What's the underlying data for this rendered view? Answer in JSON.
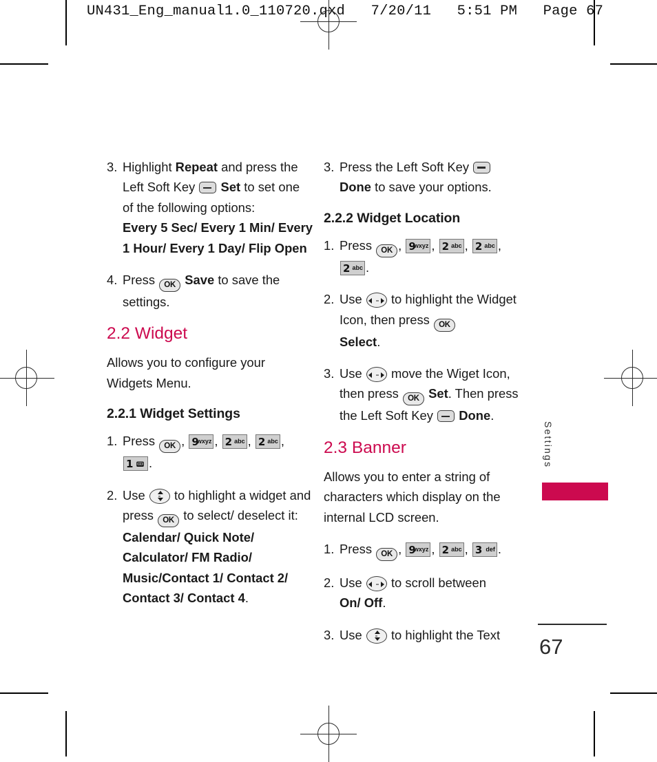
{
  "page": {
    "print_header": "UN431_Eng_manual1.0_110720.qxd   7/20/11   5:51 PM   Page 67",
    "folio": "67",
    "side_tab": "Settings",
    "accent_color": "#cc0a4f",
    "text_color": "#1a1a1a"
  },
  "left_column": {
    "step3": {
      "num": "3.",
      "t1": "Highlight ",
      "b1": "Repeat",
      "t2": " and press the Left Soft Key ",
      "key": "left-soft-key",
      "b2": "Set",
      "t3": " to set one of the following options:",
      "options": "Every 5 Sec/ Every 1 Min/ Every 1 Hour/ Every 1 Day/ Flip Open"
    },
    "step4": {
      "num": "4.",
      "t1": "Press ",
      "key": "OK",
      "b1": "Save",
      "t2": " to save the settings."
    },
    "section_2_2": {
      "heading": "2.2 Widget",
      "body": "Allows you to configure your Widgets Menu."
    },
    "subsection_2_2_1": {
      "heading": "2.2.1 Widget Settings",
      "step1": {
        "num": "1.",
        "t1": "Press ",
        "keys": [
          {
            "type": "ok",
            "digit": "OK",
            "letters": ""
          },
          {
            "type": "num",
            "digit": "9",
            "letters": "wxyz"
          },
          {
            "type": "num",
            "digit": "2",
            "letters": "abc"
          },
          {
            "type": "num",
            "digit": "2",
            "letters": "abc"
          },
          {
            "type": "num",
            "digit": "1",
            "letters": "voicemail-icon"
          }
        ],
        "t2": "."
      },
      "step2": {
        "num": "2.",
        "t1": "Use ",
        "key_nav": "up-down",
        "t2": " to highlight a widget and press ",
        "key_ok": "OK",
        "t3": " to select/ deselect it: ",
        "b1": "Calendar/ Quick Note/ Calculator/ FM Radio/ Music/Contact 1/ Contact 2/ Contact 3/ Contact 4",
        "t4": "."
      }
    }
  },
  "right_column": {
    "step3": {
      "num": "3.",
      "t1": "Press the Left Soft Key ",
      "key": "left-soft-key",
      "b1": "Done",
      "t2": " to save your options."
    },
    "subsection_2_2_2": {
      "heading": "2.2.2 Widget Location",
      "step1": {
        "num": "1.",
        "t1": "Press ",
        "keys": [
          {
            "type": "ok",
            "digit": "OK",
            "letters": ""
          },
          {
            "type": "num",
            "digit": "9",
            "letters": "wxyz"
          },
          {
            "type": "num",
            "digit": "2",
            "letters": "abc"
          },
          {
            "type": "num",
            "digit": "2",
            "letters": "abc"
          },
          {
            "type": "num",
            "digit": "2",
            "letters": "abc"
          }
        ],
        "t2": "."
      },
      "step2": {
        "num": "2.",
        "t1": "Use ",
        "key_nav": "left-right",
        "t2": " to highlight the Widget Icon, then press ",
        "key_ok": "OK",
        "b1": "Select",
        "t3": "."
      },
      "step3": {
        "num": "3.",
        "t1": "Use ",
        "key_nav": "left-right",
        "t2": " move the Wiget Icon, then press ",
        "key_ok": "OK",
        "b1": "Set",
        "t3": ". Then press the Left Soft Key ",
        "key_soft": "left-soft-key",
        "b2": "Done",
        "t4": "."
      }
    },
    "section_2_3": {
      "heading": "2.3 Banner",
      "body": "Allows you to enter a string of characters which display on the internal LCD screen.",
      "step1": {
        "num": "1.",
        "t1": "Press ",
        "keys": [
          {
            "type": "ok",
            "digit": "OK",
            "letters": ""
          },
          {
            "type": "num",
            "digit": "9",
            "letters": "wxyz"
          },
          {
            "type": "num",
            "digit": "2",
            "letters": "abc"
          },
          {
            "type": "num",
            "digit": "3",
            "letters": "def"
          }
        ],
        "t2": "."
      },
      "step2": {
        "num": "2.",
        "t1": "Use ",
        "key_nav": "left-right",
        "t2": " to scroll between ",
        "b1": "On/ Off",
        "t3": "."
      },
      "step3": {
        "num": "3.",
        "t1": "Use ",
        "key_nav": "up-down",
        "t2": " to highlight the Text"
      }
    }
  }
}
